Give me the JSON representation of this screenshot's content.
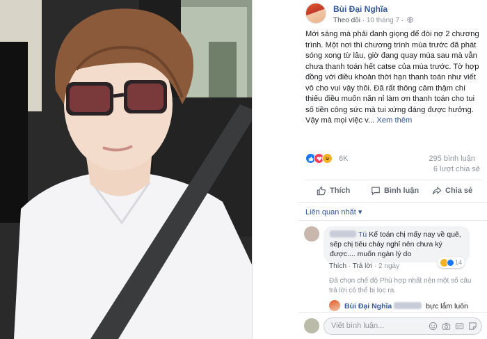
{
  "post": {
    "author_name": "Bùi Đại Nghĩa",
    "follow_label": "Theo dõi",
    "separator": " · ",
    "date": "10 tháng 7",
    "separator2": " · ",
    "text": "Mới sáng mà phải đanh giọng để đòi nợ 2 chương trình. Một nơi thì chương trình mùa trước đã phát sóng xong từ lâu, giờ đang quay mùa sau mà vẫn chưa thanh toán hết catse của mùa trước. Tờ hợp đồng với điều khoản thời hạn thanh toán như viết vô cho vui vậy thôi. Đã rất thông cảm thậm chí thiếu điều muốn năn nỉ làm ơn thanh toán cho tui số tiền công sức mà tui xứng đáng được hưởng. Vậy mà mọi việc v...",
    "see_more": "Xem thêm"
  },
  "stats": {
    "reaction_count": "6K",
    "comment_count": "295 bình luận",
    "share_count": "6 lượt chia sẻ"
  },
  "actions": {
    "like_label": "Thích",
    "comment_label": "Bình luận",
    "share_label": "Chia sẻ"
  },
  "comments": {
    "sort_label": "Liên quan nhất ▾",
    "first": {
      "author_visible_suffix": "Tú",
      "text": "Kế toán chị mấy nay về quê, sếp chị tiêu chảy nghỉ nên chưa ký được.... muốn ngàn lý do",
      "like_label": "Thích",
      "reply_label": "Trả lời",
      "time": "2 ngày",
      "reaction_count": "14"
    },
    "filter_note": "Đã chọn chế độ Phù hợp nhất nên một số câu trả lời có thể bị lọc ra.",
    "reply": {
      "author": "Bùi Đại Nghĩa",
      "text": "bực lắm luôn"
    },
    "input_placeholder": "Viết bình luận..."
  },
  "colors": {
    "link_blue": "#365899",
    "muted": "#90949c",
    "like_blue": "#1877f2",
    "love_red": "#f33e58",
    "haha_yellow": "#f7b125"
  },
  "icons": {
    "like": "thumbs-up-icon",
    "love": "heart-icon",
    "haha": "haha-icon",
    "comment": "speech-bubble-icon",
    "share": "share-arrow-icon",
    "globe": "globe-icon"
  }
}
